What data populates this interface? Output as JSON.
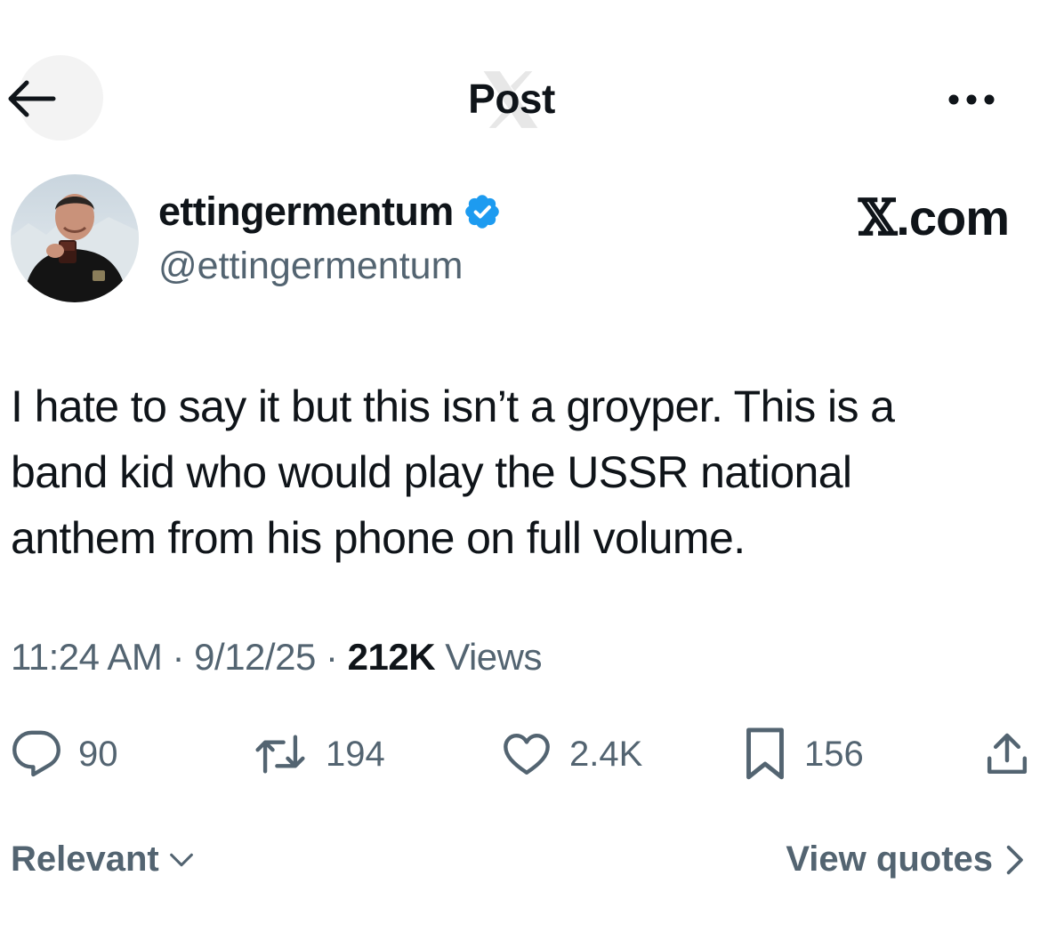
{
  "header": {
    "title": "Post",
    "back_icon": "arrow-left-icon",
    "more_icon": "more-horizontal-icon"
  },
  "author": {
    "display_name": "ettingermentum",
    "handle": "@ettingermentum",
    "verified": true,
    "verified_color": "#1d9bf0"
  },
  "watermark": {
    "x": "𝕏",
    "domain": ".com"
  },
  "tweet": {
    "text": "I hate to say it but this isn’t a groyper. This is a\nband kid who would play the USSR national\nanthem from his phone on full volume."
  },
  "meta": {
    "time": "11:24 AM",
    "separator": " · ",
    "date": "9/12/25",
    "views_count": "212K",
    "views_label": " Views"
  },
  "actions": {
    "replies": "90",
    "reposts": "194",
    "likes": "2.4K",
    "bookmarks": "156"
  },
  "footer": {
    "sort_label": "Relevant",
    "view_quotes_label": "View quotes"
  },
  "colors": {
    "text": "#0f1419",
    "secondary": "#536471",
    "accent": "#1d9bf0"
  }
}
